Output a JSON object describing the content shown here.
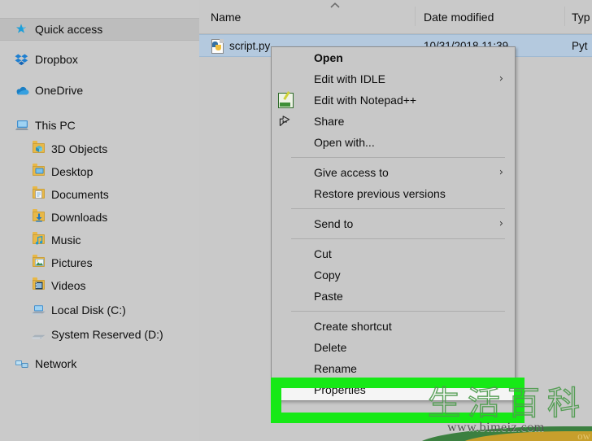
{
  "nav_pane": {
    "items": [
      {
        "label": "Quick access",
        "icon": "star-icon",
        "indent": 0,
        "selected": true
      },
      {
        "label": "Dropbox",
        "icon": "dropbox-icon",
        "indent": 0,
        "selected": false
      },
      {
        "label": "OneDrive",
        "icon": "onedrive-cloud-icon",
        "indent": 0,
        "selected": false
      },
      {
        "label": "This PC",
        "icon": "computer-icon",
        "indent": 0,
        "selected": false
      },
      {
        "label": "3D Objects",
        "icon": "folder-3d-icon",
        "indent": 1,
        "selected": false
      },
      {
        "label": "Desktop",
        "icon": "folder-desktop-icon",
        "indent": 1,
        "selected": false
      },
      {
        "label": "Documents",
        "icon": "folder-documents-icon",
        "indent": 1,
        "selected": false
      },
      {
        "label": "Downloads",
        "icon": "folder-downloads-icon",
        "indent": 1,
        "selected": false
      },
      {
        "label": "Music",
        "icon": "folder-music-icon",
        "indent": 1,
        "selected": false
      },
      {
        "label": "Pictures",
        "icon": "folder-pictures-icon",
        "indent": 1,
        "selected": false
      },
      {
        "label": "Videos",
        "icon": "folder-videos-icon",
        "indent": 1,
        "selected": false
      },
      {
        "label": "Local Disk (C:)",
        "icon": "local-disk-icon",
        "indent": 1,
        "selected": false
      },
      {
        "label": "System Reserved (D:)",
        "icon": "drive-icon",
        "indent": 1,
        "selected": false
      },
      {
        "label": "Network",
        "icon": "network-icon",
        "indent": 0,
        "selected": false
      }
    ]
  },
  "file_list": {
    "columns": [
      {
        "label": "Name",
        "sorted": true,
        "sort_icon": "chevron-up-icon"
      },
      {
        "label": "Date modified",
        "sorted": false,
        "sort_icon": ""
      },
      {
        "label": "Typ",
        "sorted": false,
        "sort_icon": ""
      }
    ],
    "rows": [
      {
        "name": "script.py",
        "icon": "python-file-icon",
        "date_modified": "10/31/2018 11:39",
        "type": "Pyt",
        "selected": true
      }
    ]
  },
  "context_menu": {
    "items": [
      {
        "label": "Open",
        "bold": true,
        "icon": "",
        "submenu": false,
        "highlighted": false
      },
      {
        "label": "Edit with IDLE",
        "bold": false,
        "icon": "",
        "submenu": true,
        "highlighted": false
      },
      {
        "label": "Edit with Notepad++",
        "bold": false,
        "icon": "notepadpp-icon",
        "submenu": false,
        "highlighted": false
      },
      {
        "label": "Share",
        "bold": false,
        "icon": "share-icon",
        "submenu": false,
        "highlighted": false
      },
      {
        "label": "Open with...",
        "bold": false,
        "icon": "",
        "submenu": false,
        "highlighted": false
      },
      {
        "separator": true
      },
      {
        "label": "Give access to",
        "bold": false,
        "icon": "",
        "submenu": true,
        "highlighted": false
      },
      {
        "label": "Restore previous versions",
        "bold": false,
        "icon": "",
        "submenu": false,
        "highlighted": false
      },
      {
        "separator": true
      },
      {
        "label": "Send to",
        "bold": false,
        "icon": "",
        "submenu": true,
        "highlighted": false
      },
      {
        "separator": true
      },
      {
        "label": "Cut",
        "bold": false,
        "icon": "",
        "submenu": false,
        "highlighted": false
      },
      {
        "label": "Copy",
        "bold": false,
        "icon": "",
        "submenu": false,
        "highlighted": false
      },
      {
        "label": "Paste",
        "bold": false,
        "icon": "",
        "submenu": false,
        "highlighted": false
      },
      {
        "separator": true
      },
      {
        "label": "Create shortcut",
        "bold": false,
        "icon": "",
        "submenu": false,
        "highlighted": false
      },
      {
        "label": "Delete",
        "bold": false,
        "icon": "",
        "submenu": false,
        "highlighted": false
      },
      {
        "label": "Rename",
        "bold": false,
        "icon": "",
        "submenu": false,
        "highlighted": false
      },
      {
        "label": "Properties",
        "bold": false,
        "icon": "",
        "submenu": false,
        "highlighted": true
      }
    ],
    "submenu_arrow_glyph": "›"
  },
  "annotation": {
    "highlight_color": "#16e916",
    "target_label": "Properties"
  },
  "watermark": {
    "cjk_text": "生活百科",
    "url": "www.bimeiz.com",
    "trailing_text": "ow"
  },
  "colors": {
    "window_background": "#c9c9c9",
    "selection_blue": "#b4c9de",
    "nav_selected": "#bdbdbd",
    "menu_background": "#c8c8c8",
    "highlight_green": "#16e916"
  }
}
